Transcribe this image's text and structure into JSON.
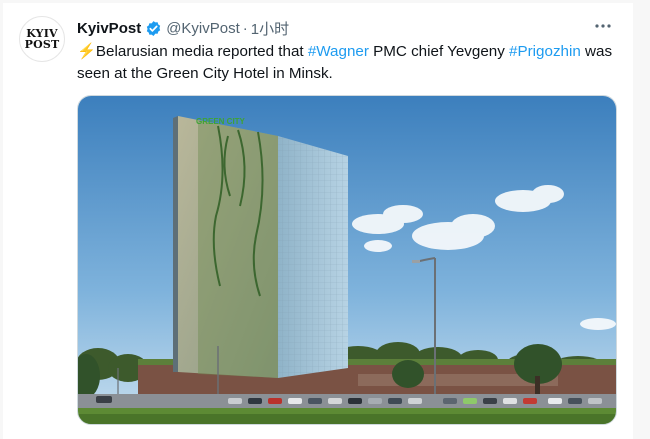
{
  "tweet": {
    "avatar_line1": "KYIV",
    "avatar_line2": "POST",
    "display_name": "KyivPost",
    "handle": "@KyivPost",
    "separator": "·",
    "time": "1小时",
    "more_icon": "ellipsis-icon",
    "verified_icon": "verified-badge-icon",
    "text_emoji": "⚡",
    "text_part1": "Belarusian media reported that ",
    "hashtag1": "#Wagner",
    "text_part2": " PMC chief Yevgeny ",
    "hashtag2": "#Prigozhin",
    "text_part3": " was seen at the Green City Hotel in Minsk.",
    "image_sign": "GREEN CITY"
  },
  "colors": {
    "link": "#1d9bf0",
    "verified": "#1d9bf0",
    "secondary_text": "#536471"
  }
}
